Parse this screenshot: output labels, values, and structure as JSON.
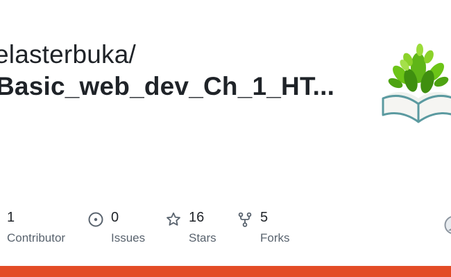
{
  "repo_card": {
    "owner": "elasterbuka/",
    "repo_name": "Basic_web_dev_Ch_1_HT...",
    "stats": {
      "contributors": {
        "count": "1",
        "label": "Contributor"
      },
      "issues": {
        "count": "0",
        "label": "Issues"
      },
      "stars": {
        "count": "16",
        "label": "Stars"
      },
      "forks": {
        "count": "5",
        "label": "Forks"
      }
    }
  },
  "icons": {
    "issues": "circle-dot-icon",
    "stars": "star-icon",
    "forks": "fork-icon",
    "logo": "book-with-leaves-logo",
    "avatar": "avatar-icon"
  },
  "colors": {
    "text_primary": "#1f2328",
    "text_muted": "#59636e",
    "language_bar": "#e34c26",
    "logo_green": "#6cc417",
    "logo_teal": "#5b9aa0"
  }
}
